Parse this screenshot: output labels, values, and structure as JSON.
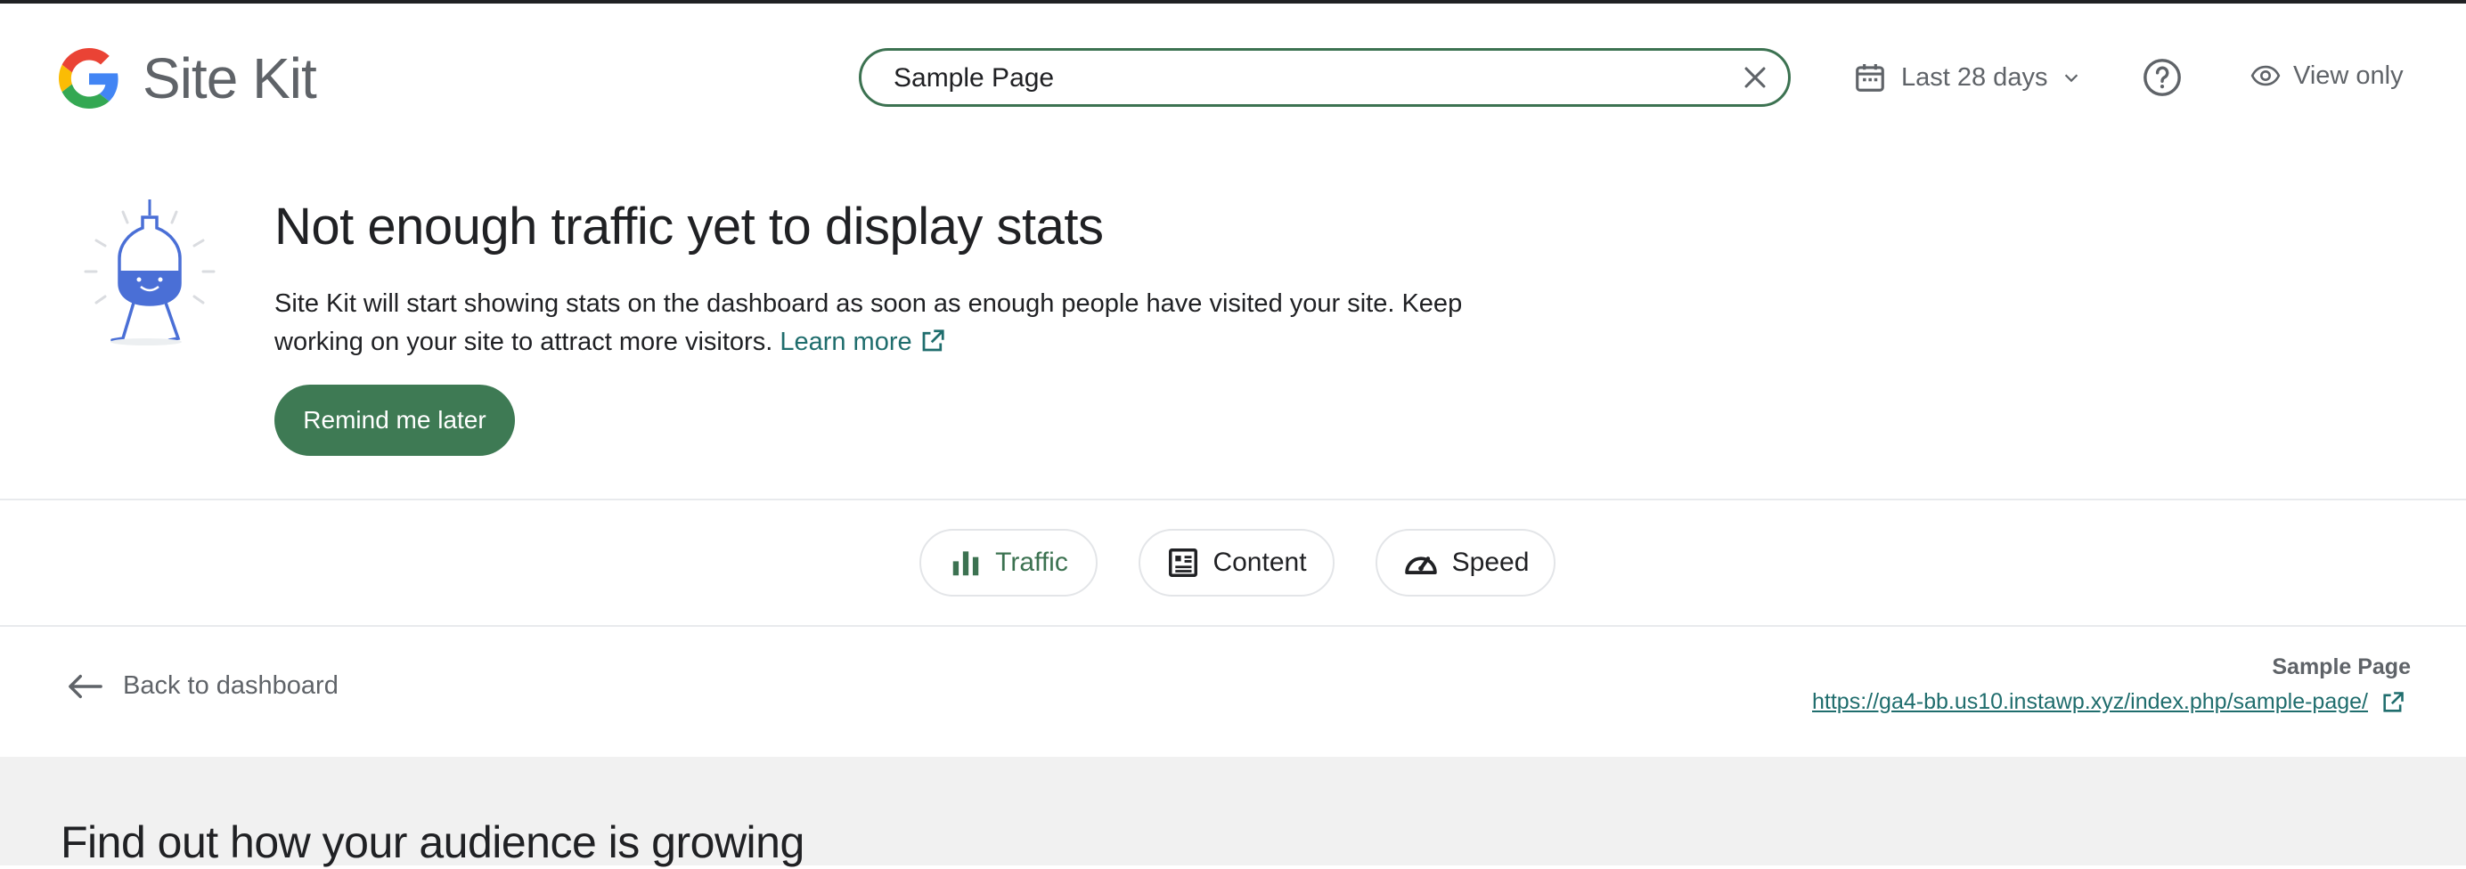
{
  "header": {
    "brand_part1": "Site",
    "brand_part2": "Kit",
    "search_value": "Sample Page",
    "date_range": "Last 28 days",
    "view_only": "View only"
  },
  "notice": {
    "title": "Not enough traffic yet to display stats",
    "body": "Site Kit will start showing stats on the dashboard as soon as enough people have visited your site. Keep working on your site to attract more visitors.",
    "learn_more": "Learn more",
    "remind_button": "Remind me later"
  },
  "tabs": [
    {
      "label": "Traffic",
      "icon": "bar-chart-icon",
      "active": true
    },
    {
      "label": "Content",
      "icon": "content-icon",
      "active": false
    },
    {
      "label": "Speed",
      "icon": "speedometer-icon",
      "active": false
    }
  ],
  "entity": {
    "back_label": "Back to dashboard",
    "page_name": "Sample Page",
    "page_url": "https://ga4-bb.us10.instawp.xyz/index.php/sample-page/"
  },
  "section": {
    "title": "Find out how your audience is growing"
  },
  "colors": {
    "accent": "#3e7a54",
    "link": "#1f6d6d",
    "muted": "#5f6368",
    "section_bg": "#f1f1f1"
  }
}
